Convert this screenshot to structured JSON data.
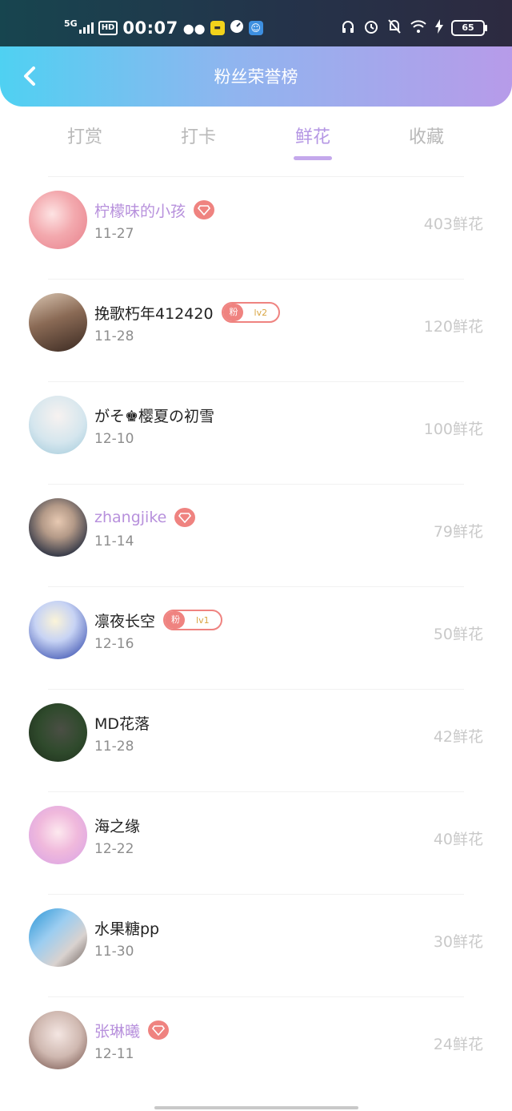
{
  "status_bar": {
    "network": "5G",
    "hd": "HD",
    "time": "00:07",
    "app_icons": [
      "wechat-icon",
      "ticket-app-icon",
      "speedometer-icon",
      "robot-app-icon"
    ],
    "right_icons": [
      "headphones-icon",
      "alarm-icon",
      "bell-off-icon",
      "wifi-icon",
      "charging-icon"
    ],
    "battery": "65"
  },
  "header": {
    "title": "粉丝荣誉榜",
    "gradient_start": "#4fd1f2",
    "gradient_end": "#b79be9"
  },
  "tabs": [
    {
      "label": "打赏",
      "active": false
    },
    {
      "label": "打卡",
      "active": false
    },
    {
      "label": "鲜花",
      "active": true
    },
    {
      "label": "收藏",
      "active": false
    }
  ],
  "ranking": [
    {
      "name": "柠檬味的小孩",
      "date": "11-27",
      "amount": "403鲜花",
      "vip": true,
      "badge": "gem"
    },
    {
      "name": "挽歌朽年412420",
      "date": "11-28",
      "amount": "120鲜花",
      "vip": false,
      "badge": "fan",
      "badge_tag": "粉",
      "badge_level": "lv2"
    },
    {
      "name": "がそ♚樱夏の初雪",
      "date": "12-10",
      "amount": "100鲜花",
      "vip": false,
      "badge": "none"
    },
    {
      "name": "zhangjike",
      "date": "11-14",
      "amount": "79鲜花",
      "vip": true,
      "badge": "gem"
    },
    {
      "name": "凛夜长空",
      "date": "12-16",
      "amount": "50鲜花",
      "vip": false,
      "badge": "fan",
      "badge_tag": "粉",
      "badge_level": "lv1"
    },
    {
      "name": "MD花落",
      "date": "11-28",
      "amount": "42鲜花",
      "vip": false,
      "badge": "none"
    },
    {
      "name": "海之缘",
      "date": "12-22",
      "amount": "40鲜花",
      "vip": false,
      "badge": "none"
    },
    {
      "name": "水果糖pp",
      "date": "11-30",
      "amount": "30鲜花",
      "vip": false,
      "badge": "none"
    },
    {
      "name": "张琳曦",
      "date": "12-11",
      "amount": "24鲜花",
      "vip": true,
      "badge": "gem"
    }
  ],
  "colors": {
    "accent": "#b597e4",
    "badge": "#ef8380",
    "vip_name": "#b790dc"
  }
}
